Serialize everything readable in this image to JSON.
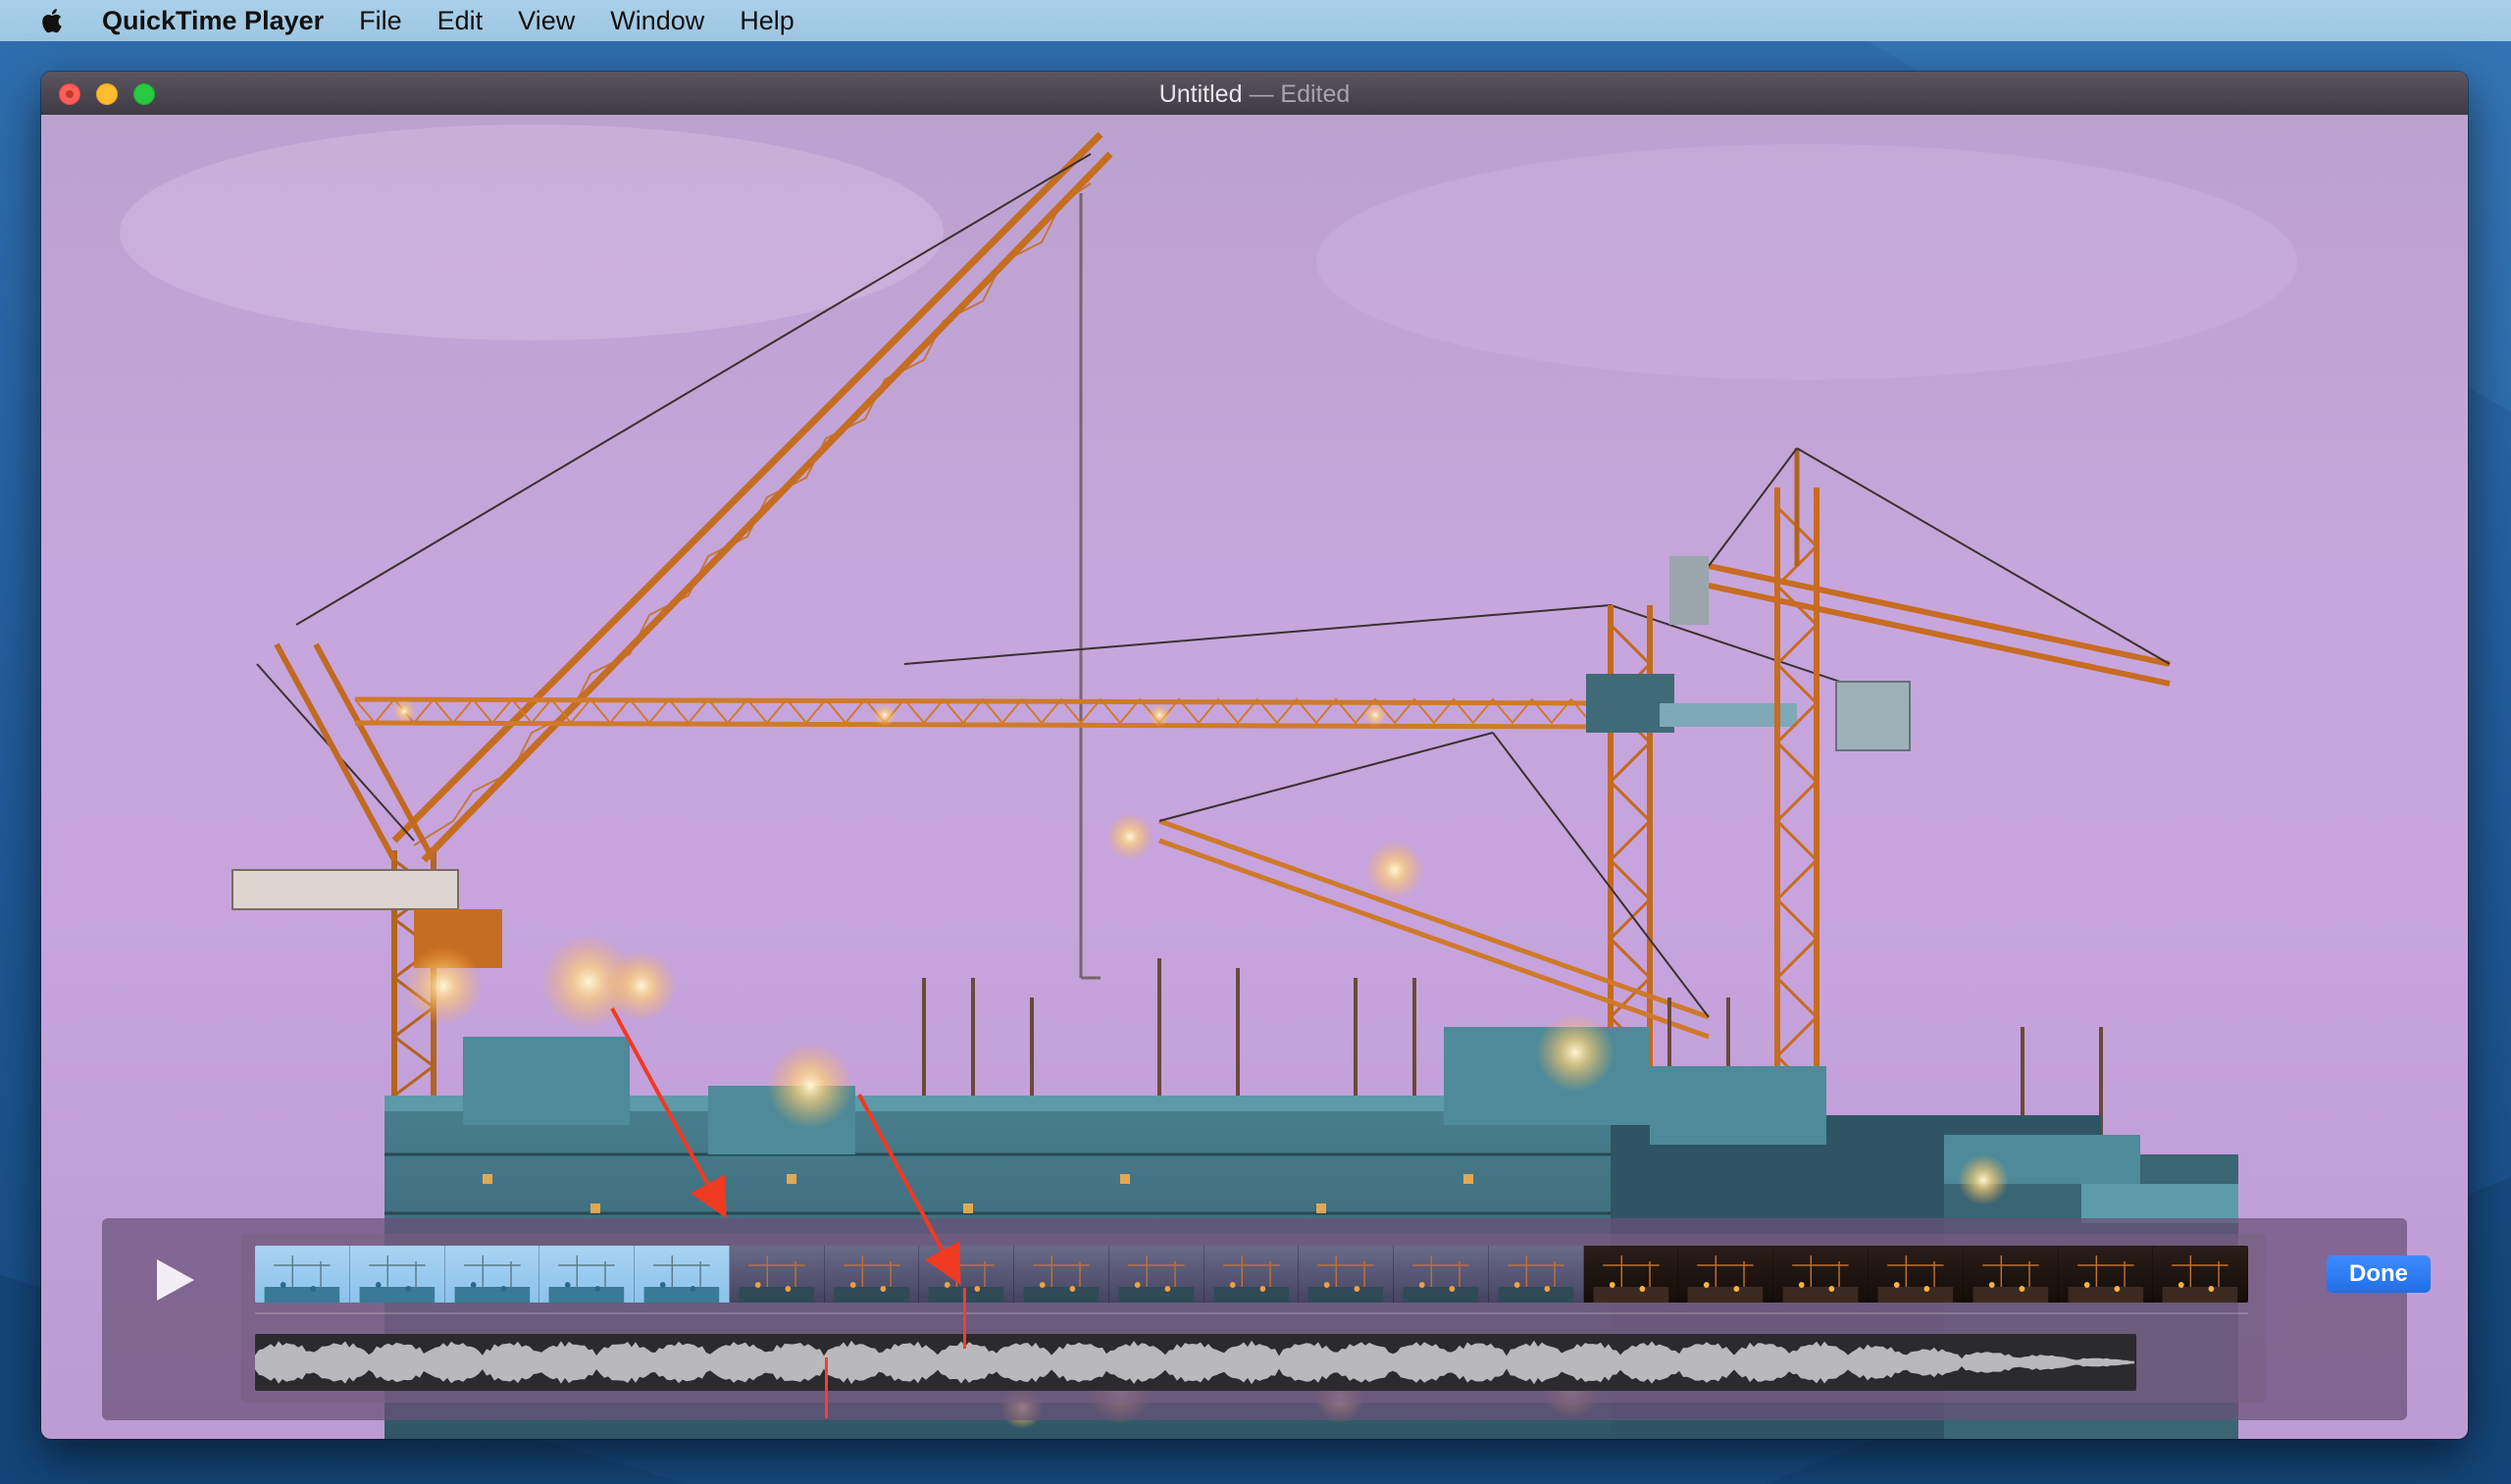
{
  "menubar": {
    "app_name": "QuickTime Player",
    "items": [
      "File",
      "Edit",
      "View",
      "Window",
      "Help"
    ]
  },
  "window": {
    "title": "Untitled",
    "separator": "—",
    "status": "Edited"
  },
  "trim": {
    "done_label": "Done"
  },
  "colors": {
    "close": "#fe5f57",
    "minimize": "#febc2e",
    "maximize": "#28c840",
    "done_button": "#1f6fe8",
    "playhead": "#ff3b30",
    "annotation_arrow": "#f03a22"
  },
  "icons": {
    "apple": "apple-icon",
    "play": "play-icon"
  }
}
